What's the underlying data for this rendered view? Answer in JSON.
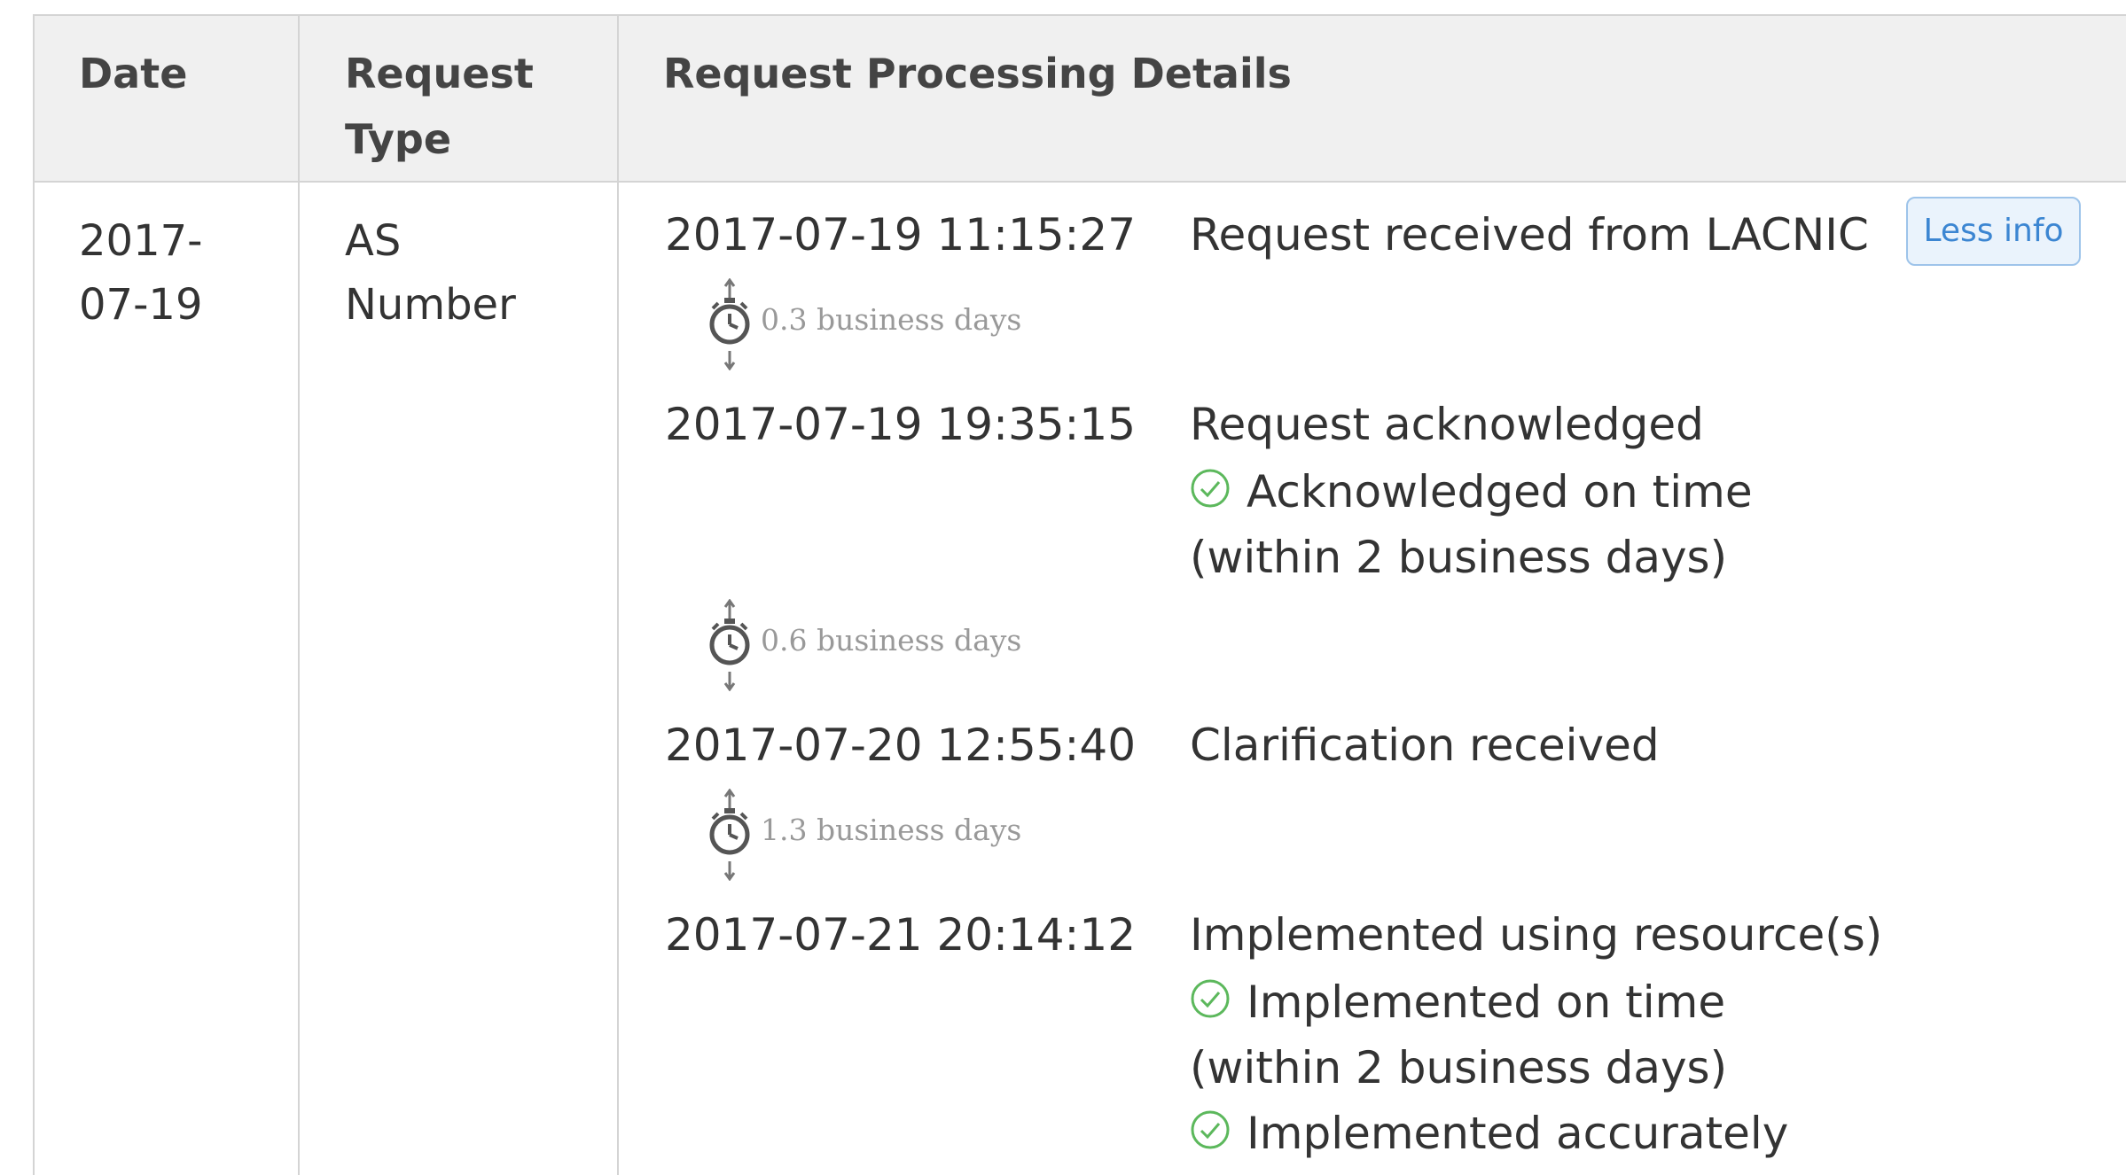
{
  "table": {
    "headers": {
      "date": "Date",
      "request_type": "Request\nType",
      "details": "Request Processing Details"
    },
    "row": {
      "date": "2017-\n07-19",
      "request_type": "AS\nNumber"
    }
  },
  "less_info_button": "Less info",
  "events": [
    {
      "time": "2017-07-19 11:15:27",
      "title": "Request received from LACNIC"
    },
    {
      "time": "2017-07-19 19:35:15",
      "title": "Request acknowledged",
      "notes": [
        "Acknowledged on time",
        "(within 2 business days)"
      ]
    },
    {
      "time": "2017-07-20 12:55:40",
      "title": "Clarification received"
    },
    {
      "time": "2017-07-21 20:14:12",
      "title": "Implemented using resource(s)",
      "notes": [
        "Implemented on time",
        "(within 2 business days)",
        "Implemented accurately"
      ]
    }
  ],
  "durations": [
    "0.3 business days",
    "0.6 business days",
    "1.3 business days"
  ],
  "icons": {
    "check": "check-circle-icon",
    "timer": "stopwatch-icon"
  },
  "colors": {
    "check": "#5cb85c",
    "button_text": "#3c86d2",
    "button_border": "#9ec4ea"
  }
}
